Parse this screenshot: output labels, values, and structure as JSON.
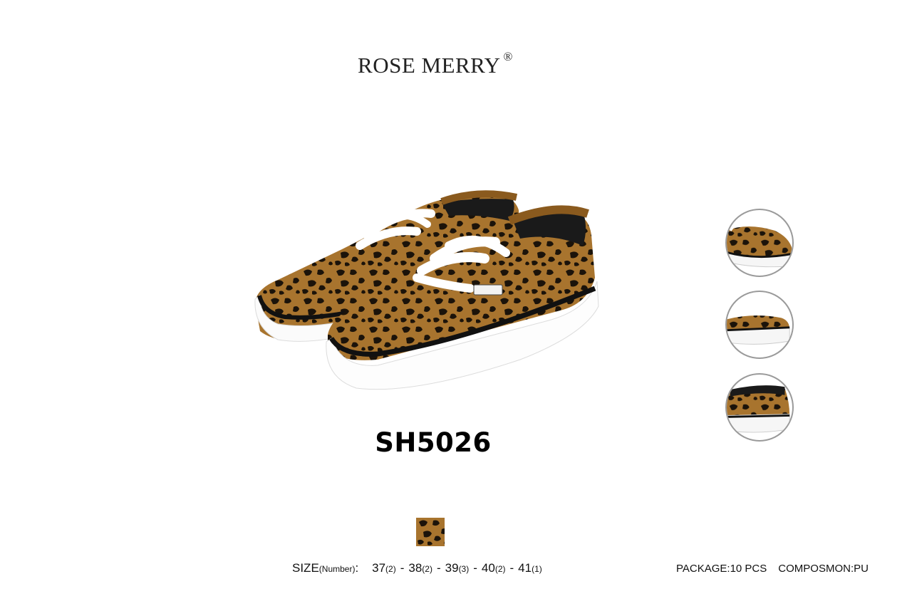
{
  "brand": {
    "name": "ROSE MERRY",
    "mark": "®"
  },
  "product": {
    "model": "SH5026"
  },
  "thumbnails": [
    {
      "view": "side-toe"
    },
    {
      "view": "side-profile"
    },
    {
      "view": "heel"
    }
  ],
  "swatch": {
    "pattern": "leopard",
    "base_color": "#b07a32",
    "spot_color": "#1a1208"
  },
  "sizes": {
    "label": "SIZE",
    "unit_label": "(Number)",
    "colon": ":",
    "items": [
      {
        "size": "37",
        "qty": "(2)"
      },
      {
        "size": "38",
        "qty": "(2)"
      },
      {
        "size": "39",
        "qty": "(3)"
      },
      {
        "size": "40",
        "qty": "(2)"
      },
      {
        "size": "41",
        "qty": "(1)"
      }
    ]
  },
  "package": "PACKAGE:10 PCS",
  "composition": "COMPOSMON:PU"
}
